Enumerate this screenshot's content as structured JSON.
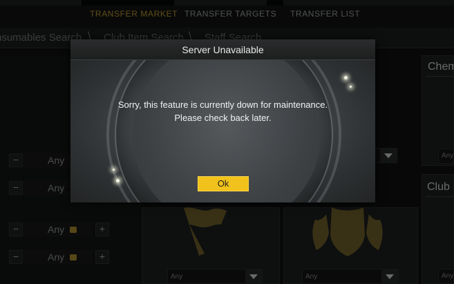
{
  "nav": {
    "tabs": [
      {
        "label": "TRANSFER MARKET",
        "active": true
      },
      {
        "label": "TRANSFER TARGETS",
        "active": false
      },
      {
        "label": "TRANSFER LIST",
        "active": false
      }
    ]
  },
  "breadcrumbs": [
    "nsumables Search",
    "Club Item Search",
    "Staff Search"
  ],
  "panels": {
    "chemistry_title": "Chem",
    "club_title": "Club"
  },
  "filters": {
    "rows": [
      {
        "value": "Any",
        "coin": false
      },
      {
        "value": "Any",
        "coin": false
      },
      {
        "value": "Any",
        "coin": true
      },
      {
        "value": "Any",
        "coin": true
      }
    ],
    "dropdowns": [
      "Any",
      "Any",
      "Any",
      "Any",
      "Any"
    ]
  },
  "modal": {
    "title": "Server Unavailable",
    "message": "Sorry, this feature is currently down for maintenance. Please check back later.",
    "ok_label": "Ok"
  },
  "icons": {
    "minus": "minus-icon",
    "plus": "plus-icon",
    "coin": "coin-icon",
    "dropdown_arrow": "chevron-down-icon",
    "flag_emblem": "flag-icon",
    "badge_emblem": "badge-icon"
  },
  "colors": {
    "accent_gold": "#b8962f",
    "ok_button": "#f0c21b",
    "modal_bg": "#262829"
  }
}
